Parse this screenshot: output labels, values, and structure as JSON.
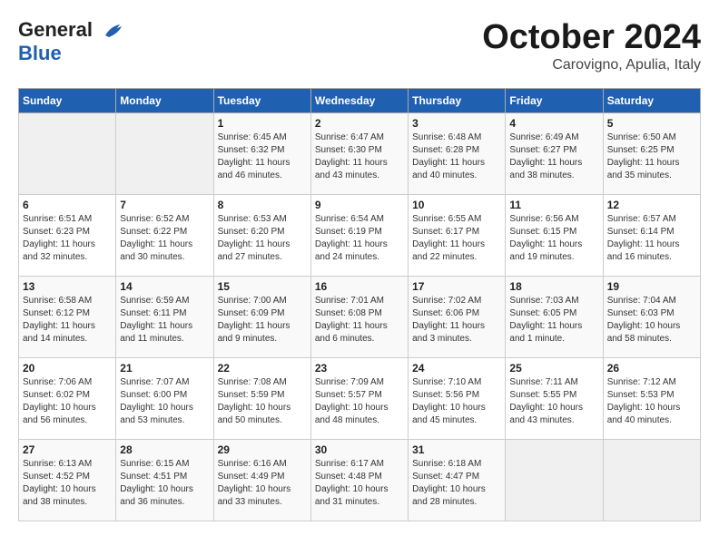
{
  "header": {
    "logo_line1": "General",
    "logo_line2": "Blue",
    "month": "October 2024",
    "location": "Carovigno, Apulia, Italy"
  },
  "days_of_week": [
    "Sunday",
    "Monday",
    "Tuesday",
    "Wednesday",
    "Thursday",
    "Friday",
    "Saturday"
  ],
  "weeks": [
    [
      {
        "num": "",
        "info": ""
      },
      {
        "num": "",
        "info": ""
      },
      {
        "num": "1",
        "info": "Sunrise: 6:45 AM\nSunset: 6:32 PM\nDaylight: 11 hours and 46 minutes."
      },
      {
        "num": "2",
        "info": "Sunrise: 6:47 AM\nSunset: 6:30 PM\nDaylight: 11 hours and 43 minutes."
      },
      {
        "num": "3",
        "info": "Sunrise: 6:48 AM\nSunset: 6:28 PM\nDaylight: 11 hours and 40 minutes."
      },
      {
        "num": "4",
        "info": "Sunrise: 6:49 AM\nSunset: 6:27 PM\nDaylight: 11 hours and 38 minutes."
      },
      {
        "num": "5",
        "info": "Sunrise: 6:50 AM\nSunset: 6:25 PM\nDaylight: 11 hours and 35 minutes."
      }
    ],
    [
      {
        "num": "6",
        "info": "Sunrise: 6:51 AM\nSunset: 6:23 PM\nDaylight: 11 hours and 32 minutes."
      },
      {
        "num": "7",
        "info": "Sunrise: 6:52 AM\nSunset: 6:22 PM\nDaylight: 11 hours and 30 minutes."
      },
      {
        "num": "8",
        "info": "Sunrise: 6:53 AM\nSunset: 6:20 PM\nDaylight: 11 hours and 27 minutes."
      },
      {
        "num": "9",
        "info": "Sunrise: 6:54 AM\nSunset: 6:19 PM\nDaylight: 11 hours and 24 minutes."
      },
      {
        "num": "10",
        "info": "Sunrise: 6:55 AM\nSunset: 6:17 PM\nDaylight: 11 hours and 22 minutes."
      },
      {
        "num": "11",
        "info": "Sunrise: 6:56 AM\nSunset: 6:15 PM\nDaylight: 11 hours and 19 minutes."
      },
      {
        "num": "12",
        "info": "Sunrise: 6:57 AM\nSunset: 6:14 PM\nDaylight: 11 hours and 16 minutes."
      }
    ],
    [
      {
        "num": "13",
        "info": "Sunrise: 6:58 AM\nSunset: 6:12 PM\nDaylight: 11 hours and 14 minutes."
      },
      {
        "num": "14",
        "info": "Sunrise: 6:59 AM\nSunset: 6:11 PM\nDaylight: 11 hours and 11 minutes."
      },
      {
        "num": "15",
        "info": "Sunrise: 7:00 AM\nSunset: 6:09 PM\nDaylight: 11 hours and 9 minutes."
      },
      {
        "num": "16",
        "info": "Sunrise: 7:01 AM\nSunset: 6:08 PM\nDaylight: 11 hours and 6 minutes."
      },
      {
        "num": "17",
        "info": "Sunrise: 7:02 AM\nSunset: 6:06 PM\nDaylight: 11 hours and 3 minutes."
      },
      {
        "num": "18",
        "info": "Sunrise: 7:03 AM\nSunset: 6:05 PM\nDaylight: 11 hours and 1 minute."
      },
      {
        "num": "19",
        "info": "Sunrise: 7:04 AM\nSunset: 6:03 PM\nDaylight: 10 hours and 58 minutes."
      }
    ],
    [
      {
        "num": "20",
        "info": "Sunrise: 7:06 AM\nSunset: 6:02 PM\nDaylight: 10 hours and 56 minutes."
      },
      {
        "num": "21",
        "info": "Sunrise: 7:07 AM\nSunset: 6:00 PM\nDaylight: 10 hours and 53 minutes."
      },
      {
        "num": "22",
        "info": "Sunrise: 7:08 AM\nSunset: 5:59 PM\nDaylight: 10 hours and 50 minutes."
      },
      {
        "num": "23",
        "info": "Sunrise: 7:09 AM\nSunset: 5:57 PM\nDaylight: 10 hours and 48 minutes."
      },
      {
        "num": "24",
        "info": "Sunrise: 7:10 AM\nSunset: 5:56 PM\nDaylight: 10 hours and 45 minutes."
      },
      {
        "num": "25",
        "info": "Sunrise: 7:11 AM\nSunset: 5:55 PM\nDaylight: 10 hours and 43 minutes."
      },
      {
        "num": "26",
        "info": "Sunrise: 7:12 AM\nSunset: 5:53 PM\nDaylight: 10 hours and 40 minutes."
      }
    ],
    [
      {
        "num": "27",
        "info": "Sunrise: 6:13 AM\nSunset: 4:52 PM\nDaylight: 10 hours and 38 minutes."
      },
      {
        "num": "28",
        "info": "Sunrise: 6:15 AM\nSunset: 4:51 PM\nDaylight: 10 hours and 36 minutes."
      },
      {
        "num": "29",
        "info": "Sunrise: 6:16 AM\nSunset: 4:49 PM\nDaylight: 10 hours and 33 minutes."
      },
      {
        "num": "30",
        "info": "Sunrise: 6:17 AM\nSunset: 4:48 PM\nDaylight: 10 hours and 31 minutes."
      },
      {
        "num": "31",
        "info": "Sunrise: 6:18 AM\nSunset: 4:47 PM\nDaylight: 10 hours and 28 minutes."
      },
      {
        "num": "",
        "info": ""
      },
      {
        "num": "",
        "info": ""
      }
    ]
  ]
}
